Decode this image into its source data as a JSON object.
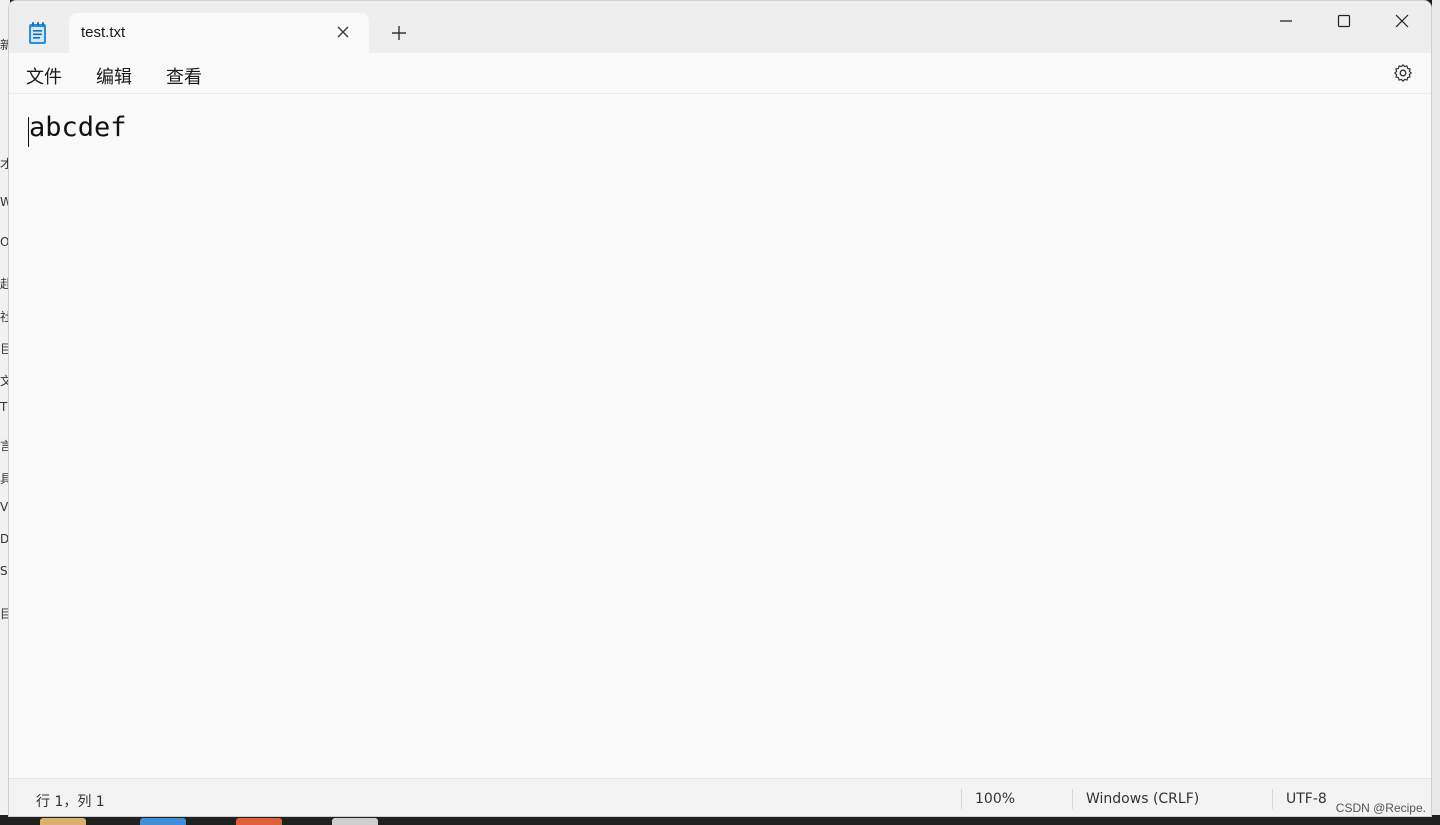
{
  "window": {
    "tab_title": "test.txt",
    "new_tab_symbol": "+",
    "controls": {
      "minimize": "minimize-icon",
      "maximize": "maximize-icon",
      "close": "close-icon"
    }
  },
  "menu": {
    "file": "文件",
    "edit": "编辑",
    "view": "查看"
  },
  "editor": {
    "content": "abcdef"
  },
  "status": {
    "position": "行 1，列 1",
    "zoom": "100%",
    "line_ending": "Windows (CRLF)",
    "encoding": "UTF-8"
  },
  "watermark": "CSDN @Recipe.",
  "background_peek": [
    "新",
    "才",
    "W",
    "O",
    "赴",
    "社",
    "巨",
    "文",
    "T",
    "言",
    "具",
    "V",
    "D",
    "S",
    "目"
  ],
  "colors": {
    "window_bg": "#f9f9f9",
    "titlebar_bg": "#eeeeee",
    "statusbar_bg": "#f3f3f3",
    "icon_blue": "#2b8fd6"
  }
}
